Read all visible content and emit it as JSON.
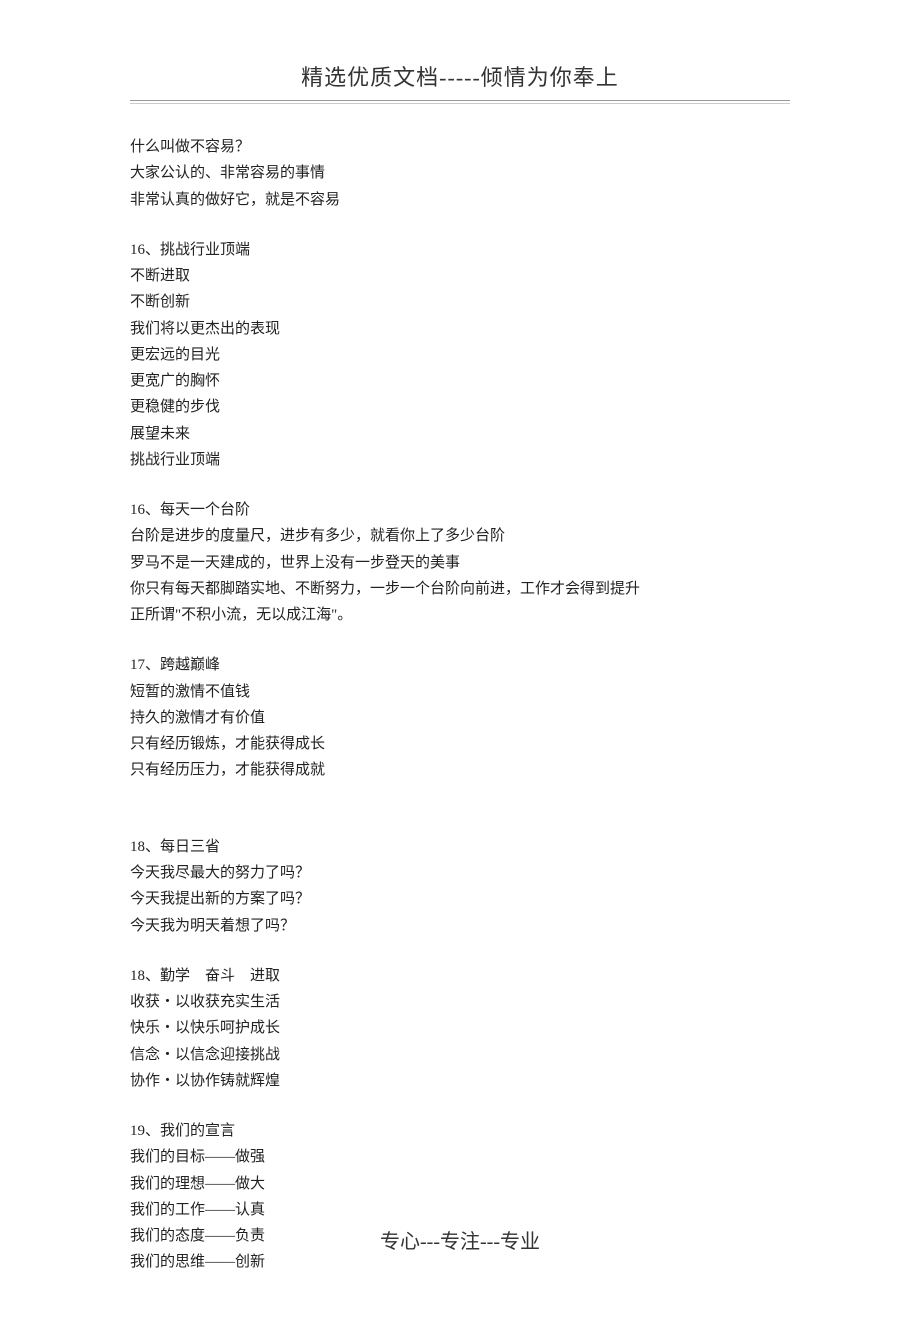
{
  "header": "精选优质文档-----倾情为你奉上",
  "footer": "专心---专注---专业",
  "blocks": [
    {
      "lines": [
        "什么叫做不容易？",
        "大家公认的、非常容易的事情",
        "非常认真的做好它，就是不容易"
      ]
    },
    {
      "lines": [
        "16、挑战行业顶端",
        "不断进取",
        "不断创新",
        "我们将以更杰出的表现",
        "更宏远的目光",
        "更宽广的胸怀",
        "更稳健的步伐",
        "展望未来",
        "挑战行业顶端"
      ]
    },
    {
      "lines": [
        "16、每天一个台阶",
        "台阶是进步的度量尺，进步有多少，就看你上了多少台阶",
        "罗马不是一天建成的，世界上没有一步登天的美事",
        "你只有每天都脚踏实地、不断努力，一步一个台阶向前进，工作才会得到提升",
        "正所谓\"不积小流，无以成江海\"。"
      ]
    },
    {
      "lines": [
        "17、跨越巅峰",
        "短暂的激情不值钱",
        "持久的激情才有价值",
        "只有经历锻炼，才能获得成长",
        "只有经历压力，才能获得成就"
      ]
    },
    {
      "lines": [
        "",
        "18、每日三省",
        "今天我尽最大的努力了吗？",
        "今天我提出新的方案了吗？",
        "今天我为明天着想了吗？"
      ]
    },
    {
      "lines": [
        "18、勤学　奋斗　进取",
        "收获・以收获充实生活",
        "快乐・以快乐呵护成长",
        "信念・以信念迎接挑战",
        "协作・以协作铸就辉煌"
      ]
    },
    {
      "lines": [
        "19、我们的宣言",
        "我们的目标——做强",
        "我们的理想——做大",
        "我们的工作——认真",
        "我们的态度——负责",
        "我们的思维——创新"
      ]
    }
  ]
}
